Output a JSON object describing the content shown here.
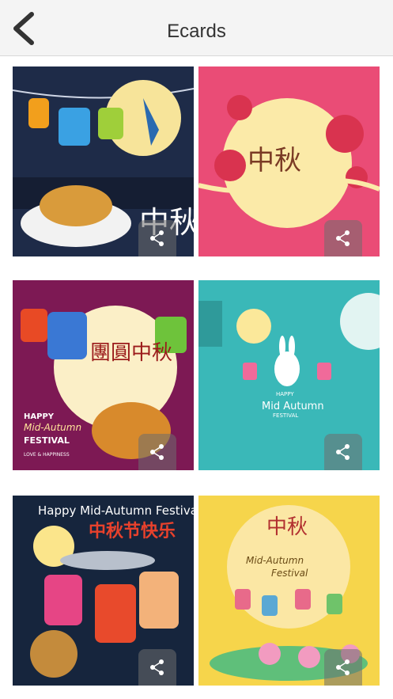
{
  "header": {
    "title": "Ecards",
    "back_icon": "chevron-left-icon"
  },
  "cards": [
    {
      "caption": "中秋"
    },
    {
      "caption": "中秋"
    },
    {
      "caption": "團圓中秋",
      "line1": "HAPPY",
      "line2": "Mid-Autumn",
      "line3": "FESTIVAL",
      "line4": "LOVE & HAPPINESS"
    },
    {
      "line1": "HAPPY",
      "line2": "Mid Autumn",
      "line3": "FESTIVAL"
    },
    {
      "heading": "Happy Mid-Autumn Festival",
      "subheading": "中秋节快乐"
    },
    {
      "caption": "中秋",
      "line1": "Mid-Autumn",
      "line2": "Festival"
    }
  ],
  "share_icon": "share-icon"
}
